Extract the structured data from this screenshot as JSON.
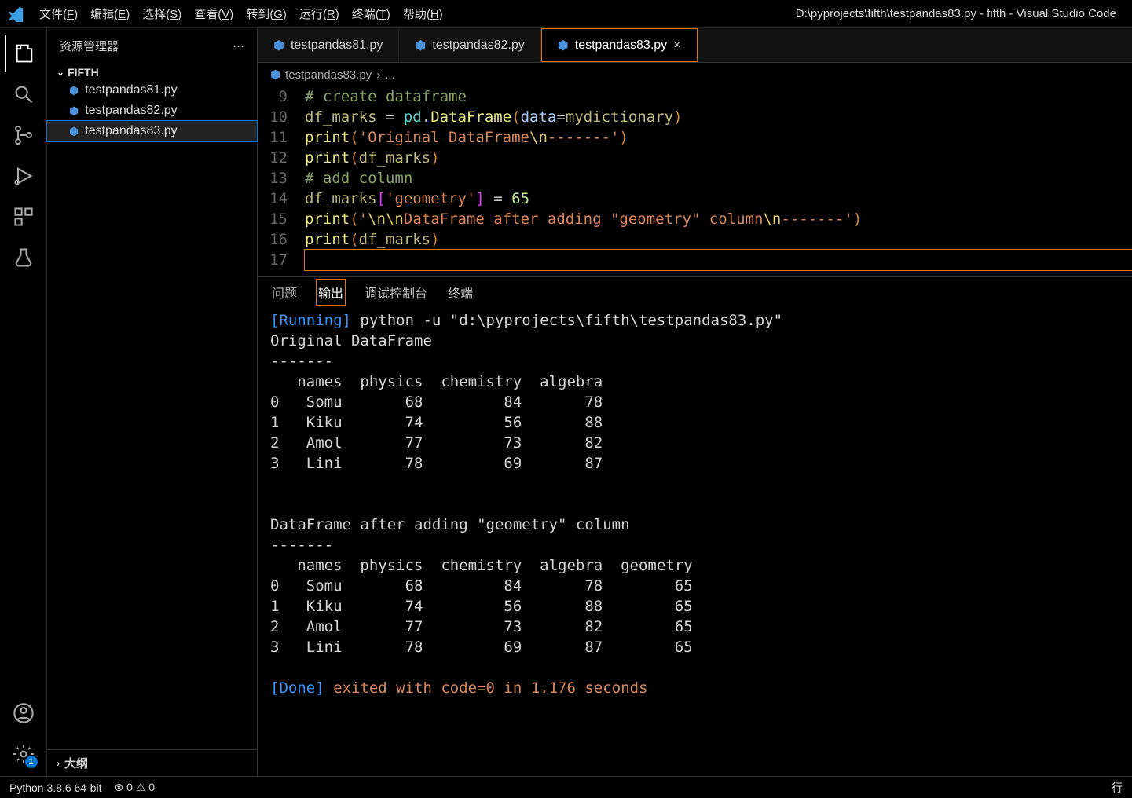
{
  "titlebar": {
    "menus": [
      "文件(F)",
      "编辑(E)",
      "选择(S)",
      "查看(V)",
      "转到(G)",
      "运行(R)",
      "终端(T)",
      "帮助(H)"
    ],
    "window_title": "D:\\pyprojects\\fifth\\testpandas83.py - fifth - Visual Studio Code"
  },
  "sidebar": {
    "title": "资源管理器",
    "more": "···",
    "folder": "FIFTH",
    "files": [
      "testpandas81.py",
      "testpandas82.py",
      "testpandas83.py"
    ],
    "active_file_index": 2,
    "outline": "大纲"
  },
  "tabs": {
    "items": [
      "testpandas81.py",
      "testpandas82.py",
      "testpandas83.py"
    ],
    "active_index": 2
  },
  "breadcrumb": {
    "file": "testpandas83.py",
    "sep": "›",
    "rest": "..."
  },
  "code": {
    "lines": [
      {
        "n": 9,
        "tokens": [
          [
            "c-comment",
            "# create dataframe"
          ]
        ]
      },
      {
        "n": 10,
        "tokens": [
          [
            "c-var",
            "df_marks"
          ],
          [
            "c-op",
            " = "
          ],
          [
            "c-ident",
            "pd"
          ],
          [
            "c-op",
            "."
          ],
          [
            "c-func",
            "DataFrame"
          ],
          [
            "c-paren",
            "("
          ],
          [
            "c-param",
            "data"
          ],
          [
            "c-op",
            "="
          ],
          [
            "c-var",
            "mydictionary"
          ],
          [
            "c-paren",
            ")"
          ]
        ]
      },
      {
        "n": 11,
        "tokens": [
          [
            "c-func",
            "print"
          ],
          [
            "c-paren",
            "("
          ],
          [
            "c-str",
            "'Original DataFrame"
          ],
          [
            "c-esc",
            "\\n"
          ],
          [
            "c-str",
            "-------'"
          ],
          [
            "c-paren",
            ")"
          ]
        ]
      },
      {
        "n": 12,
        "tokens": [
          [
            "c-func",
            "print"
          ],
          [
            "c-paren",
            "("
          ],
          [
            "c-var",
            "df_marks"
          ],
          [
            "c-paren",
            ")"
          ]
        ]
      },
      {
        "n": 13,
        "tokens": [
          [
            "c-comment",
            "# add column"
          ]
        ]
      },
      {
        "n": 14,
        "tokens": [
          [
            "c-var",
            "df_marks"
          ],
          [
            "c-brack",
            "["
          ],
          [
            "c-str",
            "'geometry'"
          ],
          [
            "c-brack",
            "]"
          ],
          [
            "c-op",
            " = "
          ],
          [
            "c-num",
            "65"
          ]
        ]
      },
      {
        "n": 15,
        "tokens": [
          [
            "c-func",
            "print"
          ],
          [
            "c-paren",
            "("
          ],
          [
            "c-str",
            "'"
          ],
          [
            "c-esc",
            "\\n\\n"
          ],
          [
            "c-str",
            "DataFrame after adding \"geometry\" column"
          ],
          [
            "c-esc",
            "\\n"
          ],
          [
            "c-str",
            "-------'"
          ],
          [
            "c-paren",
            ")"
          ]
        ]
      },
      {
        "n": 16,
        "tokens": [
          [
            "c-func",
            "print"
          ],
          [
            "c-paren",
            "("
          ],
          [
            "c-var",
            "df_marks"
          ],
          [
            "c-paren",
            ")"
          ]
        ]
      },
      {
        "n": 17,
        "tokens": [],
        "cursor": true
      }
    ]
  },
  "panel": {
    "tabs": [
      "问题",
      "输出",
      "调试控制台",
      "终端"
    ],
    "active_index": 1,
    "output": {
      "running_prefix": "[Running]",
      "running_cmd": " python -u \"d:\\pyprojects\\fifth\\testpandas83.py\"",
      "header1": "Original DataFrame",
      "dashes": "-------",
      "table1_header": "   names  physics  chemistry  algebra",
      "table1_rows": [
        "0   Somu       68         84       78",
        "1   Kiku       74         56       88",
        "2   Amol       77         73       82",
        "3   Lini       78         69       87"
      ],
      "header2": "DataFrame after adding \"geometry\" column",
      "table2_header": "   names  physics  chemistry  algebra  geometry",
      "table2_rows": [
        "0   Somu       68         84       78        65",
        "1   Kiku       74         56       88        65",
        "2   Amol       77         73       82        65",
        "3   Lini       78         69       87        65"
      ],
      "done_prefix": "[Done]",
      "done_rest": " exited with code=0 in 1.176 seconds"
    }
  },
  "statusbar": {
    "python": "Python 3.8.6 64-bit",
    "errors": "0",
    "warnings": "0",
    "line": "行"
  },
  "activity_badge": "1"
}
